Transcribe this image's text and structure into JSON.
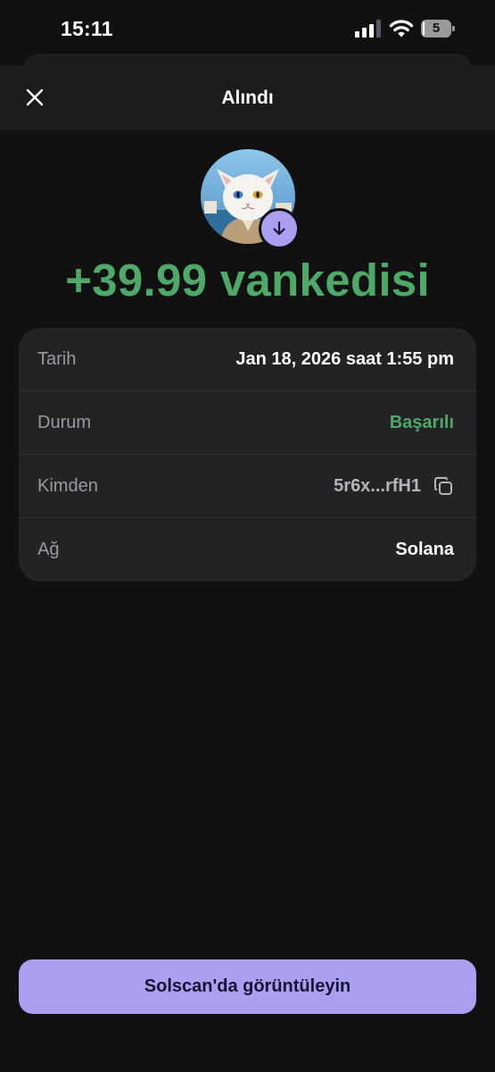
{
  "status_bar": {
    "time": "15:11",
    "battery_level": "5",
    "battery_fraction": 0.05,
    "icons": [
      "signal-icon",
      "wifi-icon",
      "battery-icon"
    ]
  },
  "header": {
    "title": "Alındı",
    "close_icon": "close-icon"
  },
  "token": {
    "avatar": "cat-avatar",
    "badge_icon": "arrow-down-icon",
    "amount": "+39.99 vankedisi"
  },
  "details": [
    {
      "label": "Tarih",
      "value": "Jan 18, 2026 saat 1:55 pm"
    },
    {
      "label": "Durum",
      "value": "Başarılı"
    },
    {
      "label": "Kimden",
      "value": "5r6x...rfH1"
    },
    {
      "label": "Ağ",
      "value": "Solana"
    }
  ],
  "actions": {
    "solscan_label": "Solscan'da görüntüleyin"
  },
  "colors": {
    "background": "#111111",
    "card": "#232325",
    "success": "#4ea868",
    "accent": "#ab9ff2",
    "label": "#9a9a9f"
  }
}
